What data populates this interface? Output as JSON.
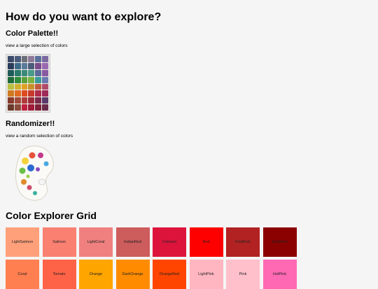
{
  "heading": "How do you want to explore?",
  "palette": {
    "title": "Color Palette!!",
    "description": "view a large selection of colors",
    "swatches": [
      "#3a4a6b",
      "#4a5a7a",
      "#6d6f7a",
      "#8f7a9a",
      "#5a6f9a",
      "#7a6aa0",
      "#2a3c5a",
      "#3e6a8a",
      "#5a7a9a",
      "#4a5c7a",
      "#7a4a8a",
      "#9a6ab0",
      "#1f5a5a",
      "#2a7a6a",
      "#3a8a7a",
      "#4a9a8a",
      "#5a6a9a",
      "#8a5aa0",
      "#1e6a3a",
      "#2e8a3a",
      "#5aa03a",
      "#7ab040",
      "#3a9a9a",
      "#6a7ab0",
      "#b8c040",
      "#d0b030",
      "#e0a020",
      "#c8902a",
      "#c05a40",
      "#b04a6a",
      "#d07a20",
      "#e06a20",
      "#e04a20",
      "#c83a2a",
      "#b02a4a",
      "#a02a5a",
      "#8a3a2a",
      "#a04a3a",
      "#b03a3a",
      "#9a2a3a",
      "#7a2a4a",
      "#5a3a6a",
      "#6a3a2a",
      "#8a4a3a",
      "#c02040",
      "#a01a3a",
      "#80203a",
      "#6a2a4a"
    ]
  },
  "randomizer": {
    "title": "Randomizer!!",
    "description": "view a random selection of colors"
  },
  "grid": {
    "title": "Color Explorer Grid",
    "cells": [
      {
        "name": "LightSalmon",
        "color": "#FFA07A"
      },
      {
        "name": "Salmon",
        "color": "#FA8072"
      },
      {
        "name": "LightCoral",
        "color": "#F08080"
      },
      {
        "name": "IndianRed",
        "color": "#CD5C5C"
      },
      {
        "name": "Crimson",
        "color": "#DC143C"
      },
      {
        "name": "Red",
        "color": "#FF0000"
      },
      {
        "name": "FireBrick",
        "color": "#B22222"
      },
      {
        "name": "DarkRed",
        "color": "#8B0000"
      },
      {
        "name": "Coral",
        "color": "#FF7F50"
      },
      {
        "name": "Tomato",
        "color": "#FF6347"
      },
      {
        "name": "Orange",
        "color": "#FFA500"
      },
      {
        "name": "DarkOrange",
        "color": "#FF8C00"
      },
      {
        "name": "OrangeRed",
        "color": "#FF4500"
      },
      {
        "name": "LightPink",
        "color": "#FFB6C1"
      },
      {
        "name": "Pink",
        "color": "#FFC0CB"
      },
      {
        "name": "HotPink",
        "color": "#FF69B4"
      }
    ]
  }
}
